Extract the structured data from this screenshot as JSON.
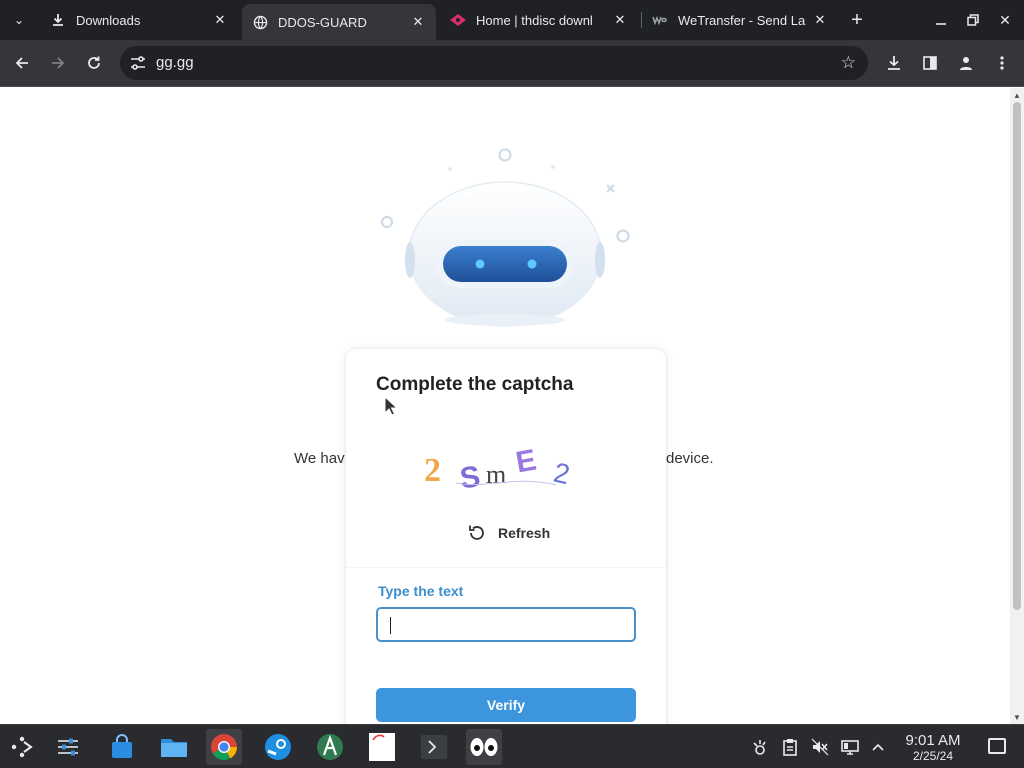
{
  "browser": {
    "tabs": [
      {
        "title": "Downloads",
        "icon": "download-icon",
        "active": false
      },
      {
        "title": "DDOS-GUARD",
        "icon": "globe-icon",
        "active": true
      },
      {
        "title": "Home | thdisc downl",
        "icon": "site-favicon",
        "active": false
      },
      {
        "title": "WeTransfer - Send La",
        "icon": "wetransfer-favicon",
        "active": false
      }
    ],
    "url": "gg.gg"
  },
  "page": {
    "background_text_left": "We hav",
    "background_text_right": "device."
  },
  "captcha": {
    "title": "Complete the captcha",
    "challenge_text": "2SmE2",
    "refresh_label": "Refresh",
    "input_label": "Type the text",
    "input_value": "",
    "verify_label": "Verify"
  },
  "colors": {
    "accent": "#3d96dd",
    "label": "#3a8fcf",
    "chrome_dark": "#202124",
    "chrome_toolbar": "#35363a"
  },
  "taskbar": {
    "apps": [
      "app-launcher",
      "system-settings",
      "discover-store",
      "file-manager",
      "chrome",
      "steam",
      "arduino",
      "text-editor",
      "terminal",
      "eyes"
    ],
    "clock_time": "9:01 AM",
    "clock_date": "2/25/24"
  }
}
